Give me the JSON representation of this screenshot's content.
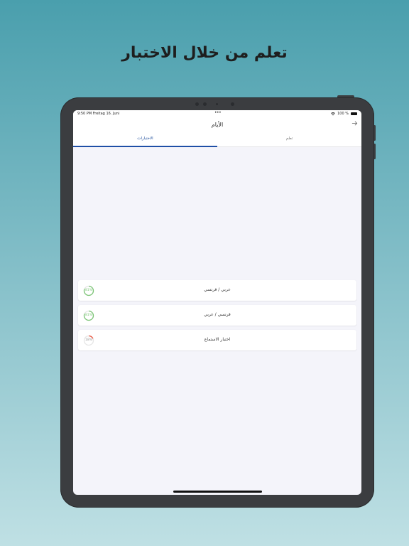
{
  "headline": "تعلم من خلال الاختبار",
  "status_bar": {
    "time": "9:50 PM  Freitag 16. Juni",
    "dots": "•••",
    "battery": "100 %"
  },
  "nav": {
    "title": "الأيام",
    "back_icon": "arrow-right-icon"
  },
  "tabs": [
    {
      "label": "الاختبارات",
      "active": true
    },
    {
      "label": "تعلم",
      "active": false
    }
  ],
  "tests": [
    {
      "label": "عربي / فرنسي",
      "progress_label": "81%",
      "progress": 0.81,
      "color": "#7cc576"
    },
    {
      "label": "فرنسي / عربي",
      "progress_label": "81%",
      "progress": 0.81,
      "color": "#7cc576"
    },
    {
      "label": "اختبار الاستماع",
      "progress_label": "18%",
      "progress": 0.18,
      "color": "#e8503a"
    }
  ],
  "colors": {
    "accent": "#1f4fa6",
    "progress_good": "#7cc576",
    "progress_low": "#e8503a"
  }
}
